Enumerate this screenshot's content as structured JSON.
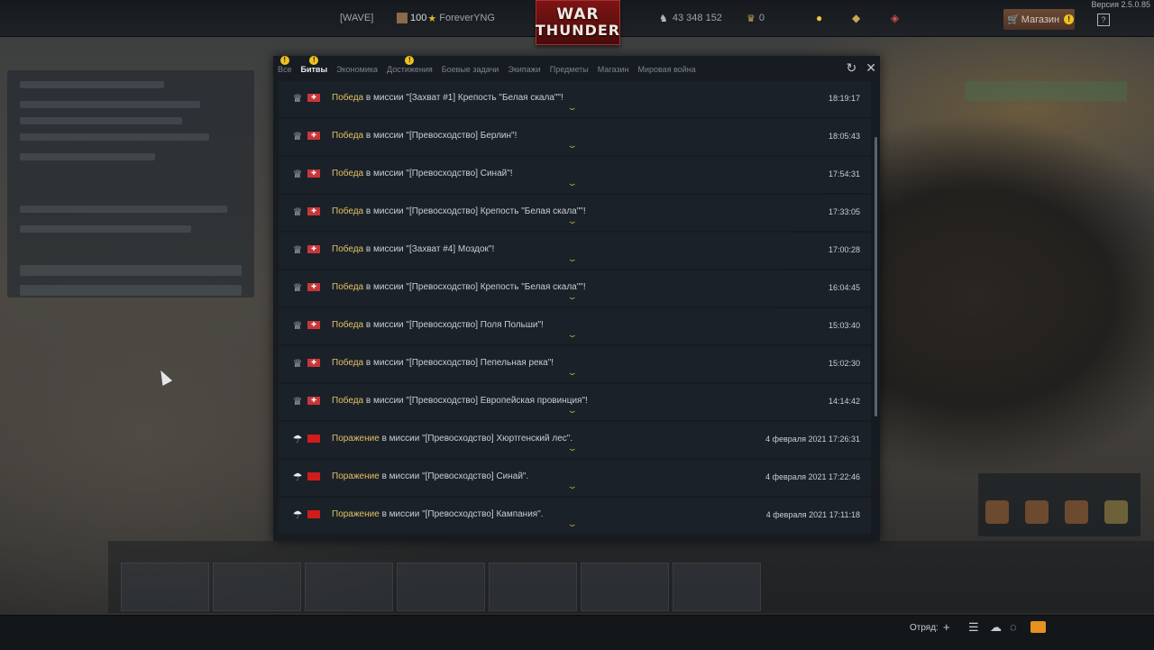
{
  "app": {
    "version": "Версия 2.5.0.85"
  },
  "topbar": {
    "squadron": "[WAVE]",
    "level": "100",
    "nickname": "ForeverYNG",
    "logo_line1": "WAR",
    "logo_line2": "THUNDER",
    "silver_lions": "43 348 152",
    "golden_eagles": "0",
    "shop_label": "Магазин",
    "help_label": "?"
  },
  "tabs": [
    {
      "label": "Все",
      "active": false,
      "warn": true
    },
    {
      "label": "Битвы",
      "active": true,
      "warn": true
    },
    {
      "label": "Экономика",
      "active": false,
      "warn": false
    },
    {
      "label": "Достижения",
      "active": false,
      "warn": true
    },
    {
      "label": "Боевые задачи",
      "active": false,
      "warn": false
    },
    {
      "label": "Экипажи",
      "active": false,
      "warn": false
    },
    {
      "label": "Предметы",
      "active": false,
      "warn": false
    },
    {
      "label": "Магазин",
      "active": false,
      "warn": false
    },
    {
      "label": "Мировая война",
      "active": false,
      "warn": false
    }
  ],
  "warn_symbol": "!",
  "entries": [
    {
      "result": "Победа",
      "text": " в миссии \"[Захват #1] Крепость \"Белая скала\"\"!",
      "time": "18:19:17",
      "nation": "germany",
      "icon": "trophy-icon"
    },
    {
      "result": "Победа",
      "text": " в миссии \"[Превосходство] Берлин\"!",
      "time": "18:05:43",
      "nation": "germany",
      "icon": "trophy-icon"
    },
    {
      "result": "Победа",
      "text": " в миссии \"[Превосходство] Синай\"!",
      "time": "17:54:31",
      "nation": "germany",
      "icon": "trophy-icon"
    },
    {
      "result": "Победа",
      "text": " в миссии \"[Превосходство] Крепость \"Белая скала\"\"!",
      "time": "17:33:05",
      "nation": "germany",
      "icon": "trophy-icon"
    },
    {
      "result": "Победа",
      "text": " в миссии \"[Захват #4] Моздок\"!",
      "time": "17:00:28",
      "nation": "germany",
      "icon": "trophy-icon"
    },
    {
      "result": "Победа",
      "text": " в миссии \"[Превосходство] Крепость \"Белая скала\"\"!",
      "time": "16:04:45",
      "nation": "germany",
      "icon": "trophy-icon"
    },
    {
      "result": "Победа",
      "text": " в миссии \"[Превосходство] Поля Польши\"!",
      "time": "15:03:40",
      "nation": "germany",
      "icon": "trophy-icon"
    },
    {
      "result": "Победа",
      "text": " в миссии \"[Превосходство] Пепельная река\"!",
      "time": "15:02:30",
      "nation": "germany",
      "icon": "trophy-icon"
    },
    {
      "result": "Победа",
      "text": " в миссии \"[Превосходство] Европейская провинция\"!",
      "time": "14:14:42",
      "nation": "germany",
      "icon": "trophy-icon"
    },
    {
      "result": "Поражение",
      "text": " в миссии \"[Превосходство] Хюртгенский лес\".",
      "time": "4 февраля 2021 17:26:31",
      "nation": "ussr",
      "icon": "parachute-icon"
    },
    {
      "result": "Поражение",
      "text": " в миссии \"[Превосходство] Синай\".",
      "time": "4 февраля 2021 17:22:46",
      "nation": "ussr",
      "icon": "parachute-icon"
    },
    {
      "result": "Поражение",
      "text": " в миссии \"[Превосходство] Кампания\".",
      "time": "4 февраля 2021 17:11:18",
      "nation": "ussr",
      "icon": "parachute-icon"
    }
  ],
  "footer": {
    "squad_label": "Отряд:"
  },
  "colors": {
    "result_accent": "#e0c266",
    "flag_germany": "#c8363a",
    "flag_ussr": "#cf1c1c",
    "warn_badge": "#f0c020",
    "mail": "#e89020"
  }
}
